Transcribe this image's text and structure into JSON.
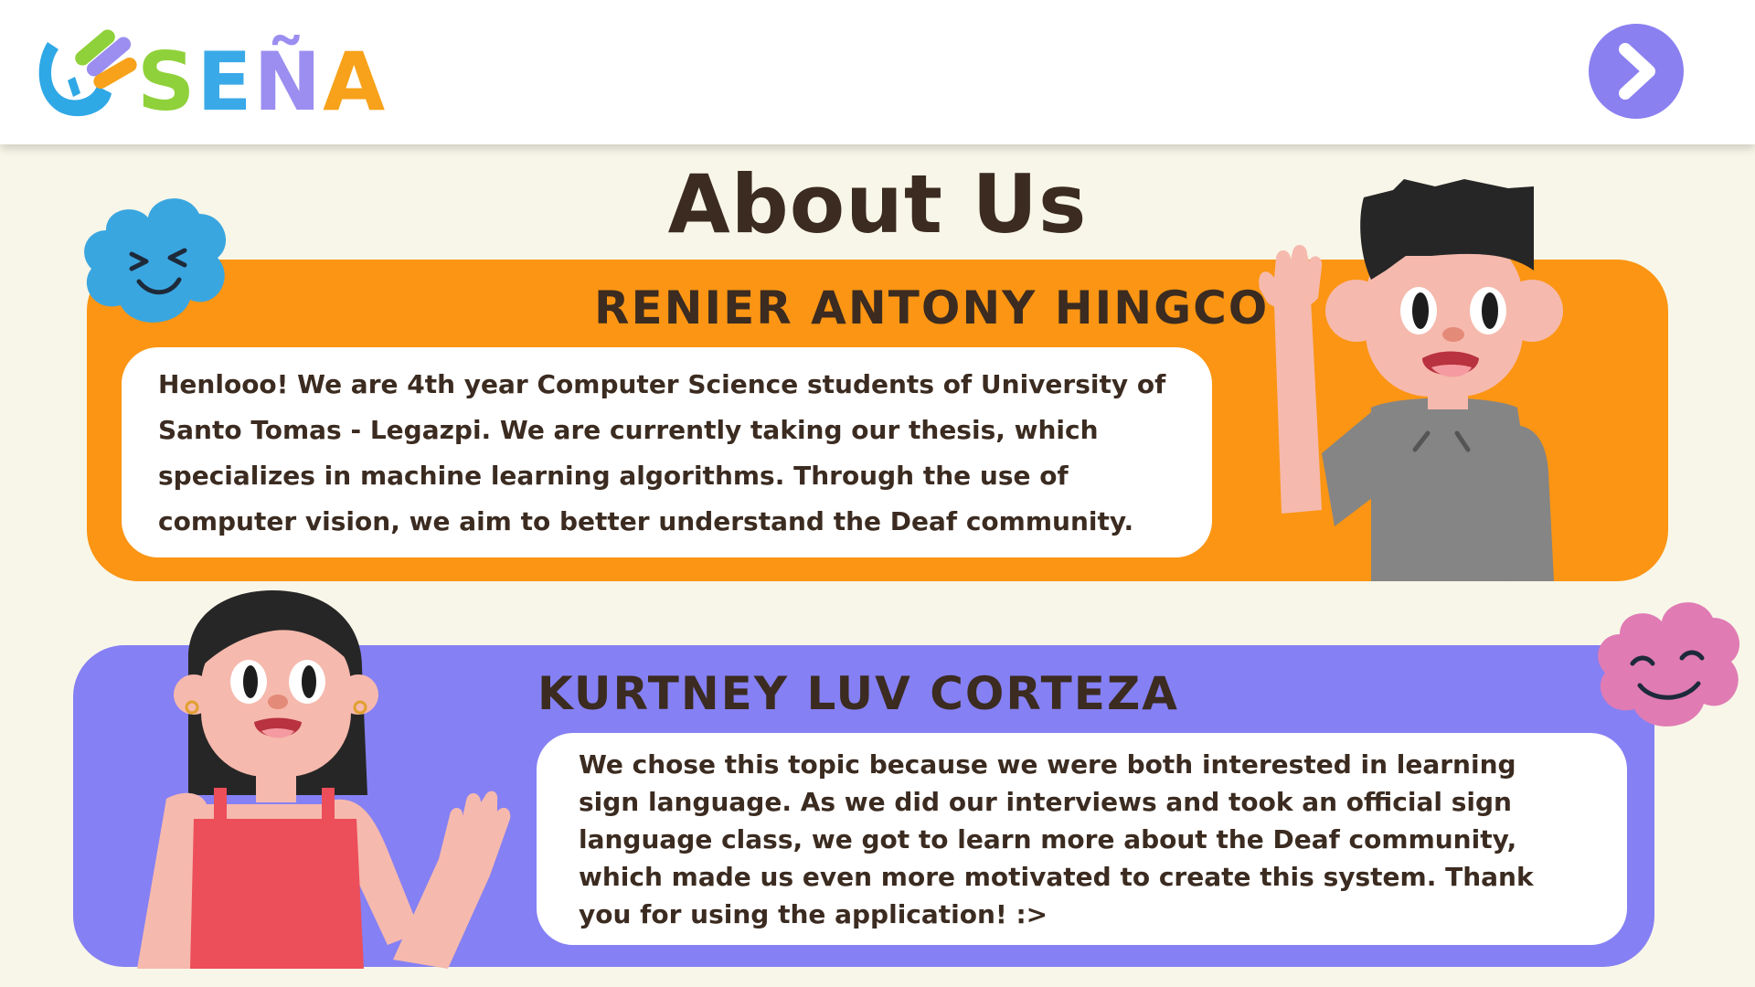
{
  "header": {
    "logo_letters": [
      "S",
      "E",
      "Ñ",
      "A"
    ],
    "logo_colors": [
      "#8fd13a",
      "#3aa9e8",
      "#9b8ef0",
      "#f7a21a"
    ],
    "next_icon": "chevron-right-icon"
  },
  "page": {
    "title": "About Us"
  },
  "members": [
    {
      "name": "RENIER ANTONY HINGCO",
      "bio": "Henlooo! We are 4th year Computer Science students of University of Santo Tomas - Legazpi. We are currently taking our thesis, which specializes in machine learning algorithms. Through the use of computer vision, we aim to better understand the Deaf community."
    },
    {
      "name": "KURTNEY LUV CORTEZA",
      "bio": "We chose this topic because we were both interested in learning sign language. As we did our interviews and took an official sign language class, we got to learn more about the Deaf community, which made us even more motivated to create this system. Thank you for using the application! :>"
    }
  ],
  "colors": {
    "background": "#f8f6e8",
    "card_orange": "#fb9513",
    "card_purple": "#8580f3",
    "text_dark": "#3b2b20",
    "blob_blue": "#3aa6e0",
    "blob_pink": "#e07bb4"
  },
  "decorations": {
    "blue_blob": "smiling-cloud-icon",
    "pink_blob": "smiling-cloud-icon",
    "male_character": "waving-boy-illustration",
    "female_character": "waving-girl-illustration"
  }
}
